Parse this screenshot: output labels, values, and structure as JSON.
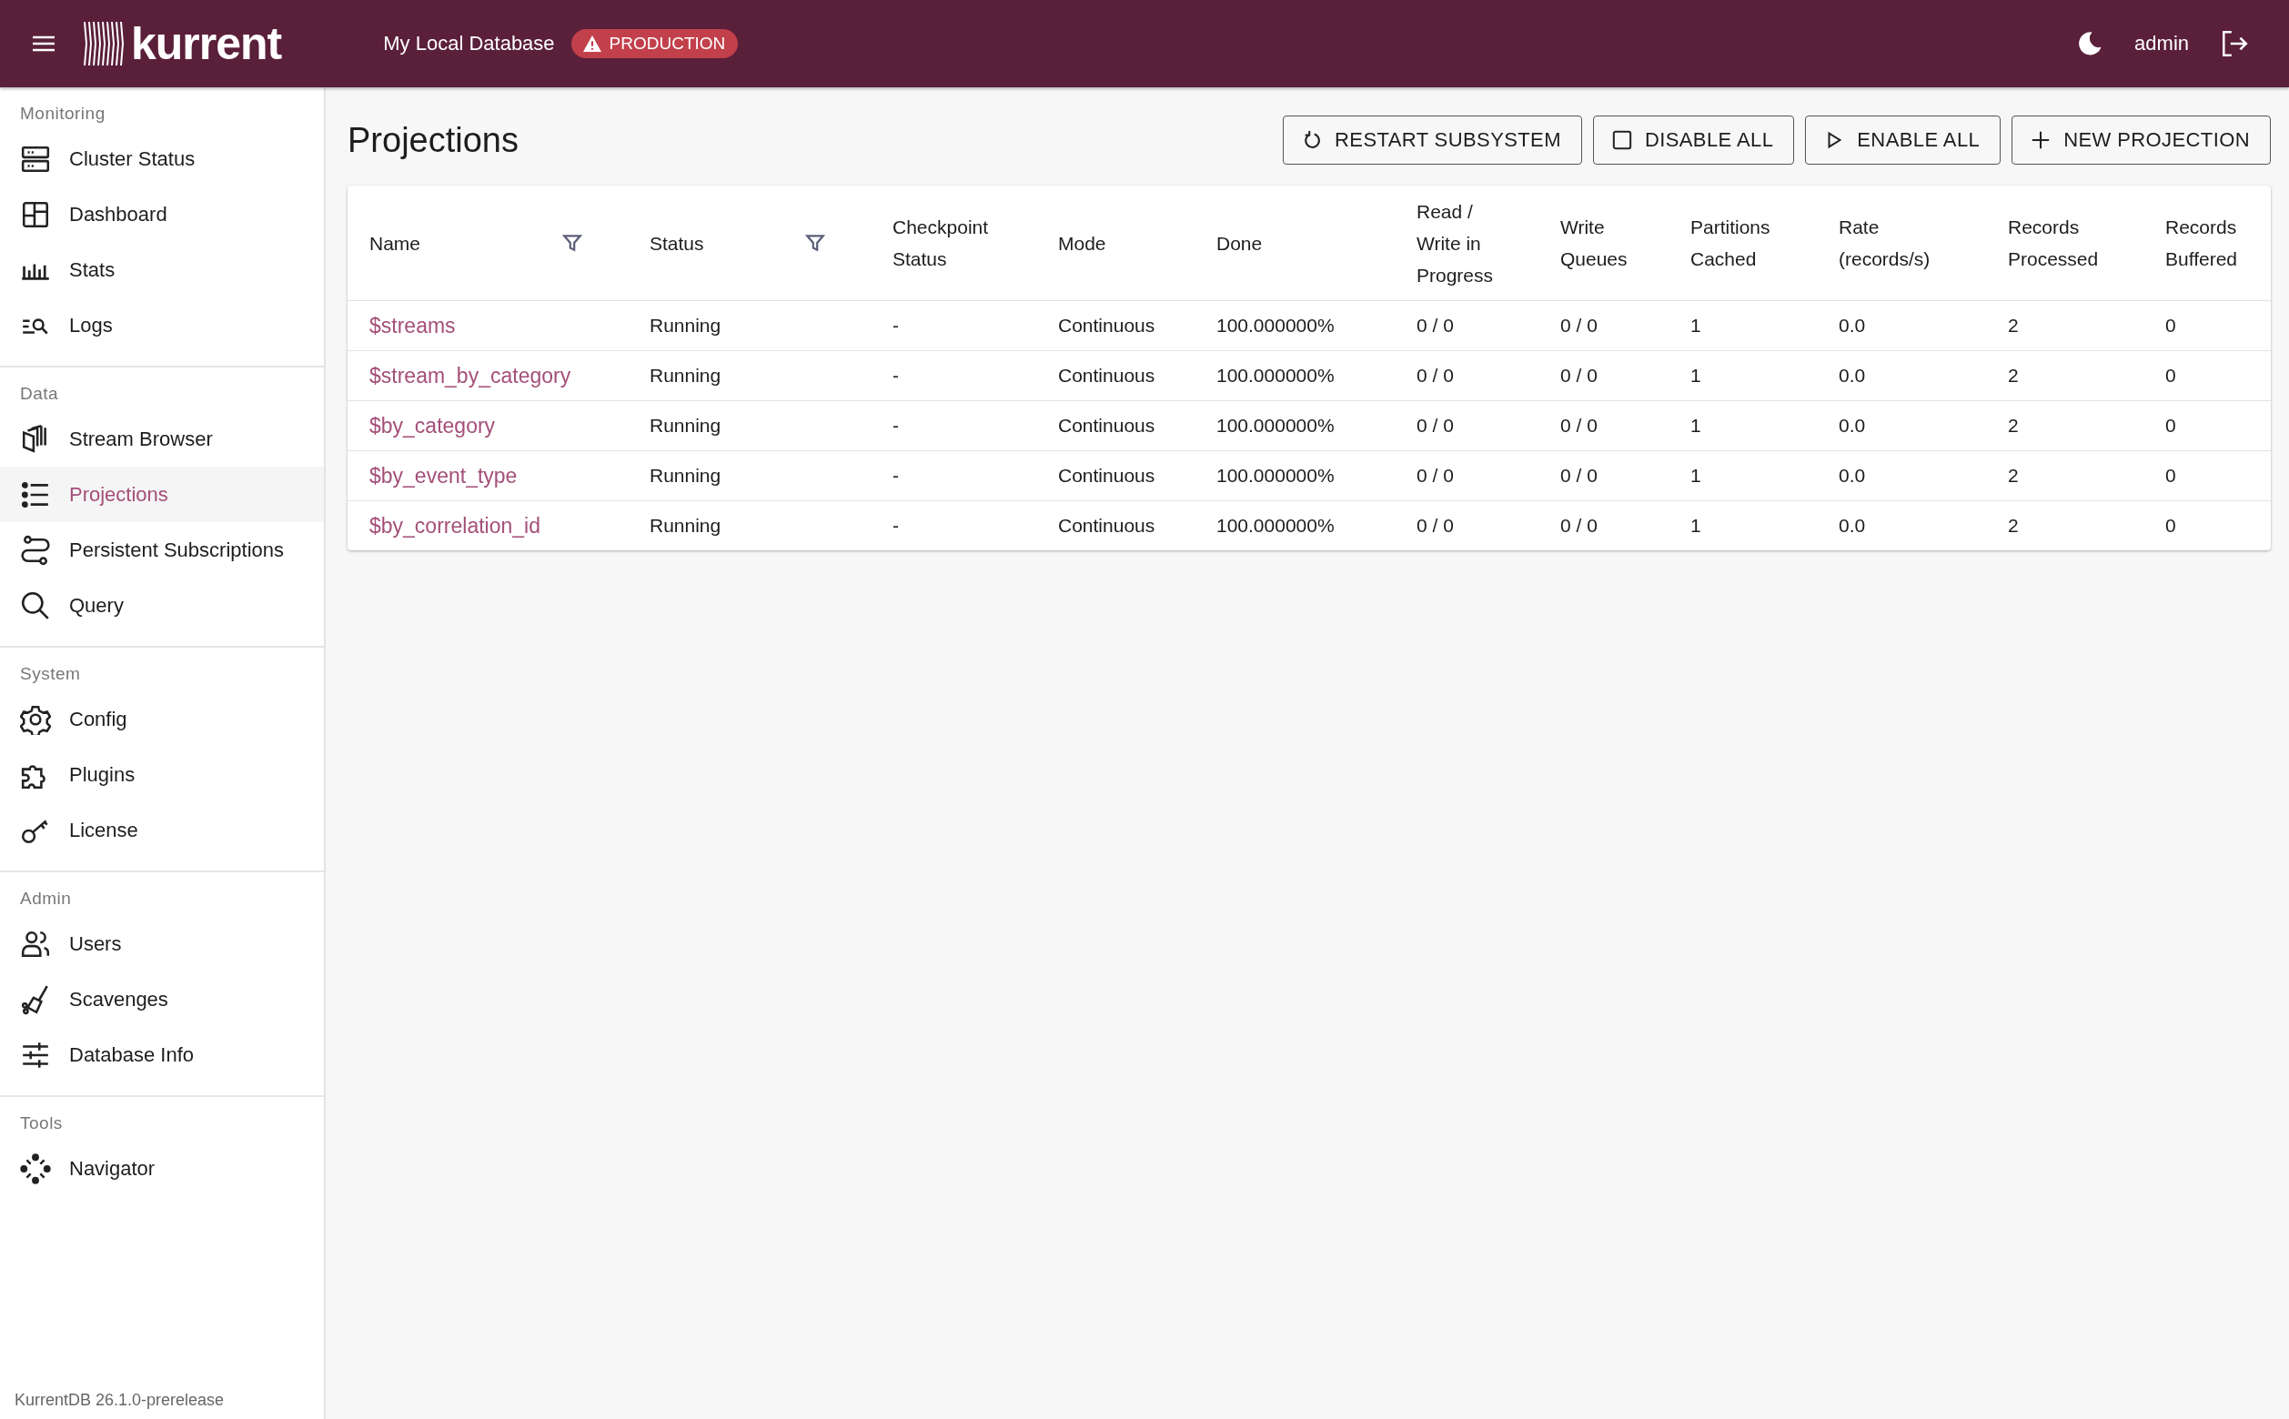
{
  "header": {
    "logo": "kurrent",
    "database": "My Local Database",
    "environment_badge": "PRODUCTION",
    "user": "admin"
  },
  "sidebar": {
    "sections": [
      {
        "title": "Monitoring",
        "items": [
          {
            "label": "Cluster Status",
            "selected": false
          },
          {
            "label": "Dashboard",
            "selected": false
          },
          {
            "label": "Stats",
            "selected": false
          },
          {
            "label": "Logs",
            "selected": false
          }
        ]
      },
      {
        "title": "Data",
        "items": [
          {
            "label": "Stream Browser",
            "selected": false
          },
          {
            "label": "Projections",
            "selected": true
          },
          {
            "label": "Persistent Subscriptions",
            "selected": false
          },
          {
            "label": "Query",
            "selected": false
          }
        ]
      },
      {
        "title": "System",
        "items": [
          {
            "label": "Config",
            "selected": false
          },
          {
            "label": "Plugins",
            "selected": false
          },
          {
            "label": "License",
            "selected": false
          }
        ]
      },
      {
        "title": "Admin",
        "items": [
          {
            "label": "Users",
            "selected": false
          },
          {
            "label": "Scavenges",
            "selected": false
          },
          {
            "label": "Database Info",
            "selected": false
          }
        ]
      },
      {
        "title": "Tools",
        "items": [
          {
            "label": "Navigator",
            "selected": false
          }
        ]
      }
    ],
    "version": "KurrentDB 26.1.0-prerelease"
  },
  "page": {
    "title": "Projections",
    "buttons": [
      {
        "kind": "restart",
        "label": "RESTART SUBSYSTEM"
      },
      {
        "kind": "disable",
        "label": "DISABLE ALL"
      },
      {
        "kind": "enable",
        "label": "ENABLE ALL"
      },
      {
        "kind": "new",
        "label": "NEW PROJECTION"
      }
    ]
  },
  "table": {
    "columns": [
      {
        "label": "Name",
        "filter": true
      },
      {
        "label": "Status",
        "filter": true
      },
      {
        "label": "Checkpoint Status",
        "filter": false
      },
      {
        "label": "Mode",
        "filter": false
      },
      {
        "label": "Done",
        "filter": false
      },
      {
        "label": "Read / Write in Progress",
        "filter": false
      },
      {
        "label": "Write Queues",
        "filter": false
      },
      {
        "label": "Partitions Cached",
        "filter": false
      },
      {
        "label": "Rate (records/s)",
        "filter": false
      },
      {
        "label": "Records Processed",
        "filter": false
      },
      {
        "label": "Records Buffered",
        "filter": false
      }
    ],
    "rows": [
      [
        "$streams",
        "Running",
        "-",
        "Continuous",
        "100.000000%",
        "0 / 0",
        "0 / 0",
        "1",
        "0.0",
        "2",
        "0"
      ],
      [
        "$stream_by_category",
        "Running",
        "-",
        "Continuous",
        "100.000000%",
        "0 / 0",
        "0 / 0",
        "1",
        "0.0",
        "2",
        "0"
      ],
      [
        "$by_category",
        "Running",
        "-",
        "Continuous",
        "100.000000%",
        "0 / 0",
        "0 / 0",
        "1",
        "0.0",
        "2",
        "0"
      ],
      [
        "$by_event_type",
        "Running",
        "-",
        "Continuous",
        "100.000000%",
        "0 / 0",
        "0 / 0",
        "1",
        "0.0",
        "2",
        "0"
      ],
      [
        "$by_correlation_id",
        "Running",
        "-",
        "Continuous",
        "100.000000%",
        "0 / 0",
        "0 / 0",
        "1",
        "0.0",
        "2",
        "0"
      ]
    ]
  }
}
